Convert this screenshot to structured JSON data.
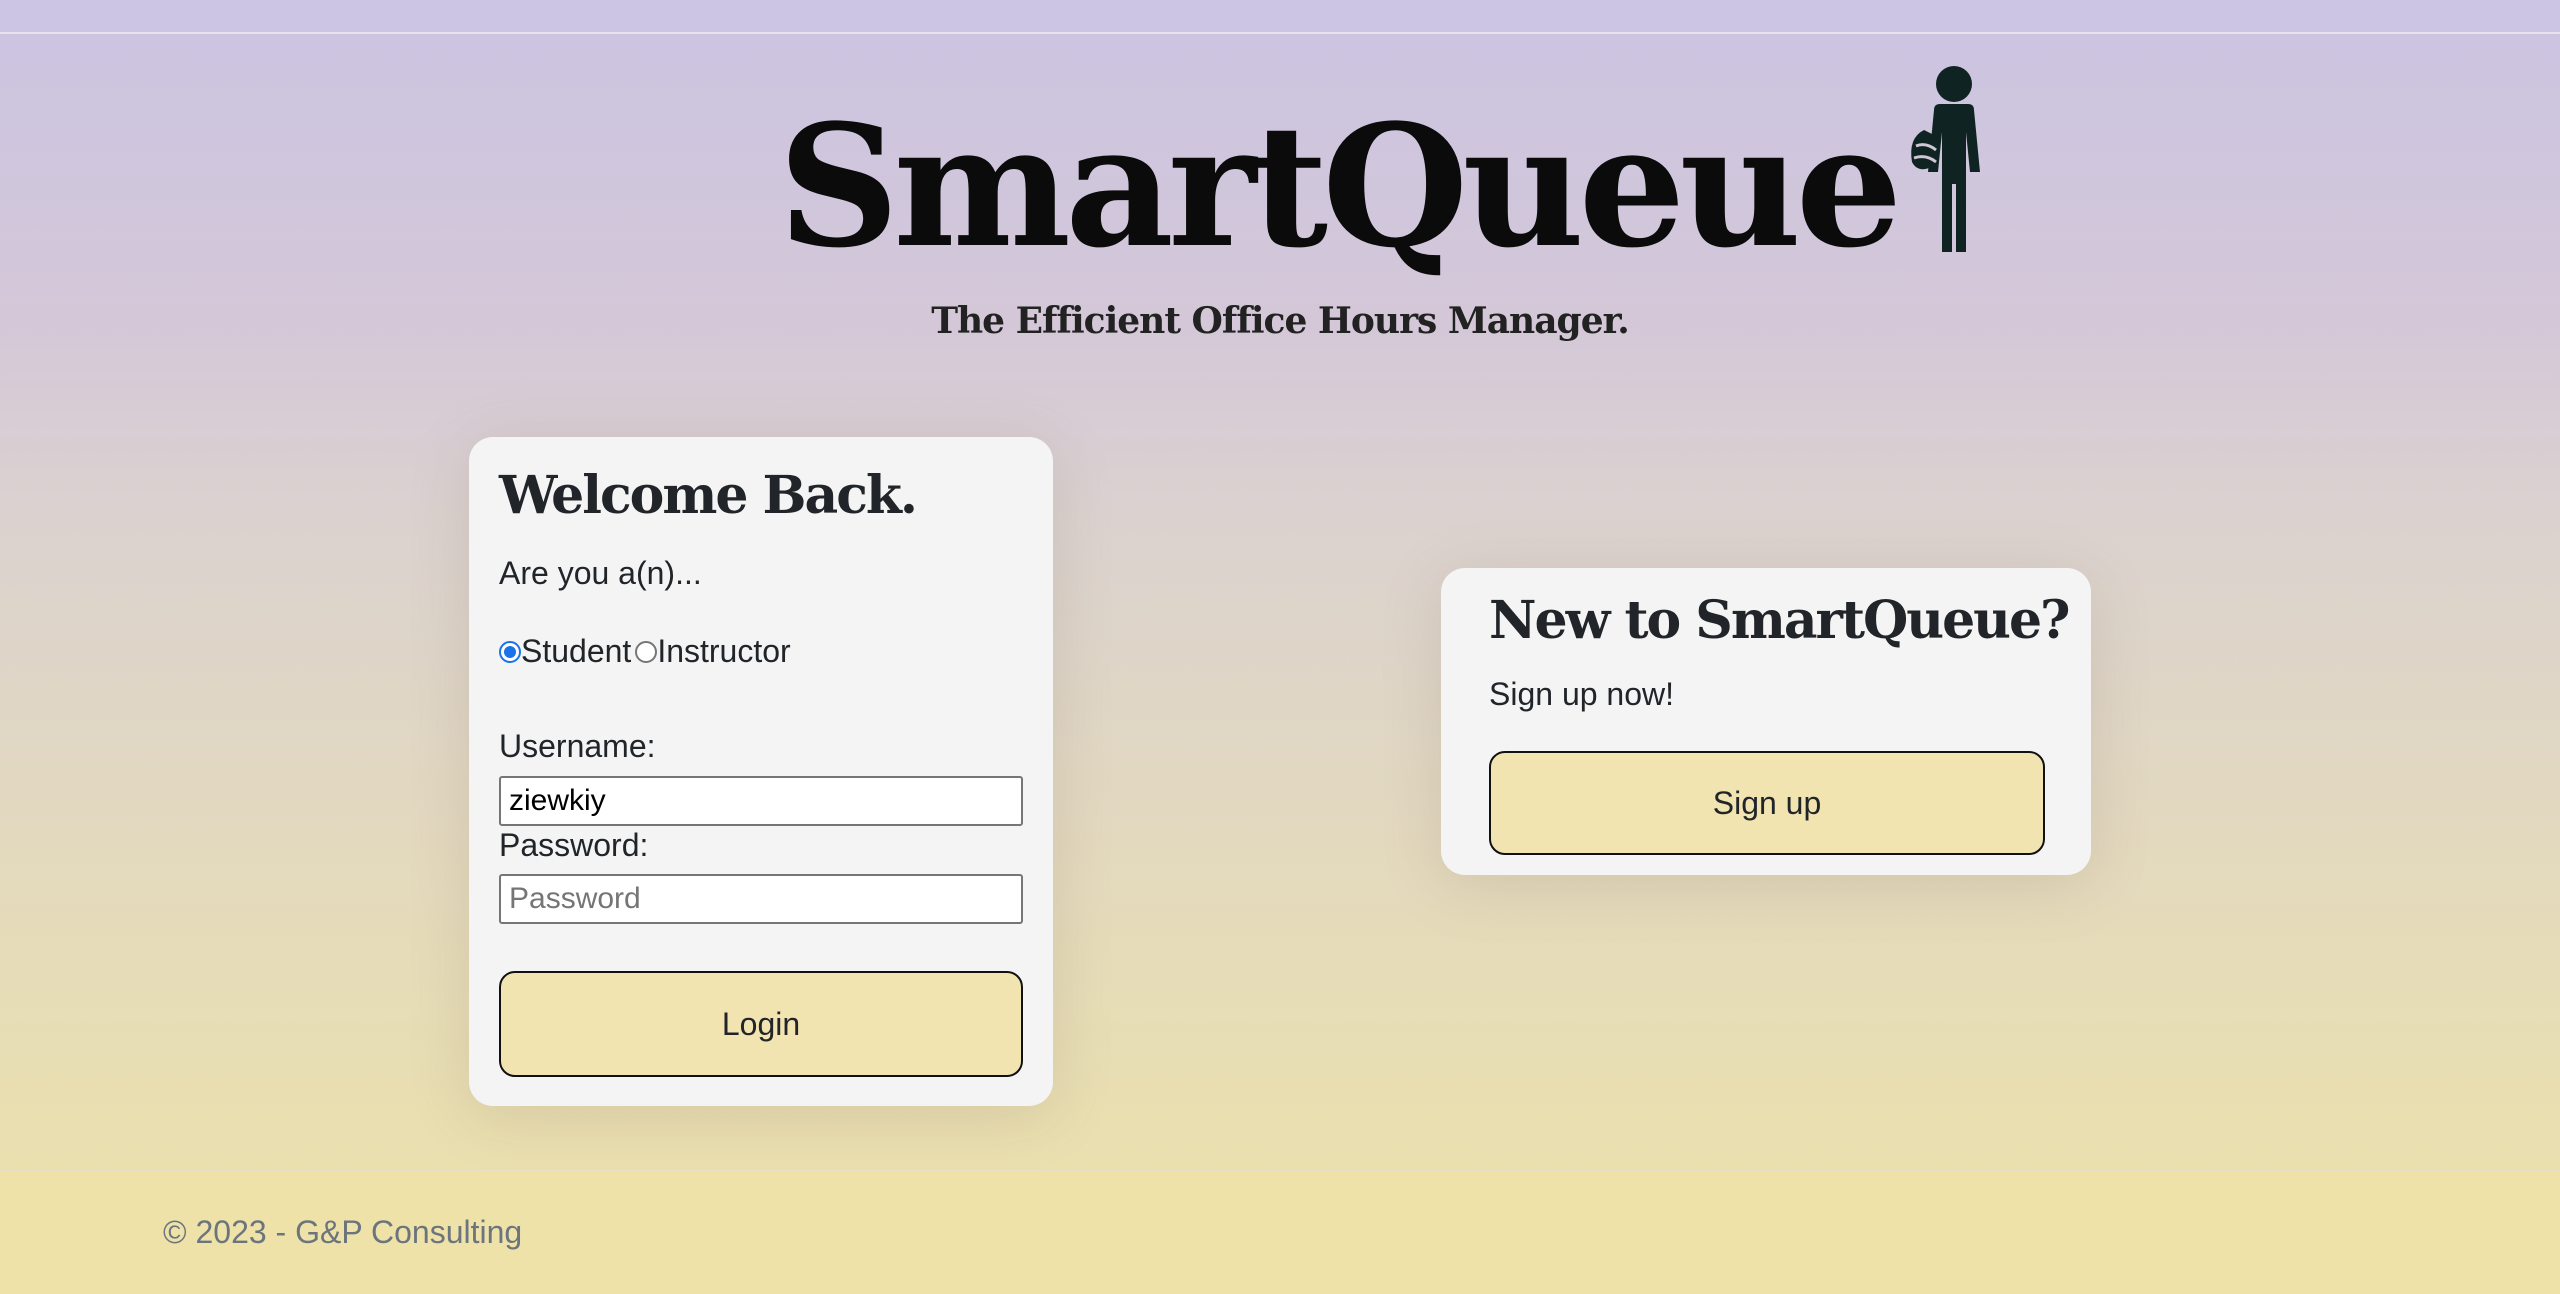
{
  "app": {
    "logo_text": "SmartQueue",
    "tagline": "The Efficient Office Hours Manager."
  },
  "login": {
    "title": "Welcome Back.",
    "role_prompt": "Are you a(n)...",
    "roles": [
      {
        "label": "Student",
        "selected": true
      },
      {
        "label": "Instructor",
        "selected": false
      }
    ],
    "username_label": "Username:",
    "username_value": "ziewkiy",
    "password_label": "Password:",
    "password_placeholder": "Password",
    "login_button": "Login"
  },
  "signup": {
    "title": "New to SmartQueue?",
    "subtitle": "Sign up now!",
    "button": "Sign up"
  },
  "footer": {
    "copyright": "© 2023 - G&P Consulting"
  },
  "colors": {
    "button_bg": "#f2e4b0",
    "card_bg": "#f4f4f4",
    "radio_accent": "#1a73e8",
    "footer_bg": "#eee2a9"
  },
  "icons": {
    "logo_figure": "person-with-bag-icon"
  }
}
